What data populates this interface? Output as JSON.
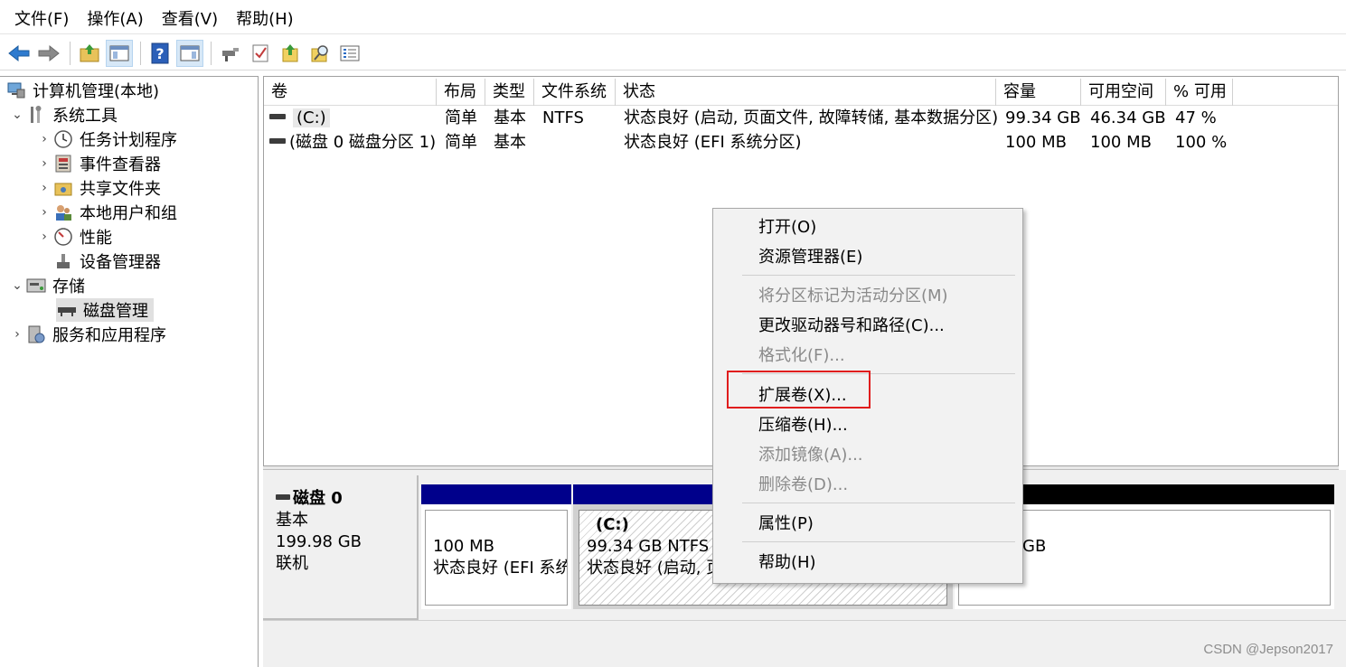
{
  "menu": [
    "文件(F)",
    "操作(A)",
    "查看(V)",
    "帮助(H)"
  ],
  "toolbar_icons": [
    "back-arrow-icon",
    "forward-arrow-icon",
    "up-folder-icon",
    "console-tree-icon",
    "help-icon",
    "action-pane-icon",
    "connect-icon",
    "properties-icon",
    "export-icon",
    "search-icon",
    "list-icon"
  ],
  "tree": {
    "root": "计算机管理(本地)",
    "system_tools": "系统工具",
    "task_scheduler": "任务计划程序",
    "event_viewer": "事件查看器",
    "shared_folders": "共享文件夹",
    "local_users": "本地用户和组",
    "performance": "性能",
    "device_manager": "设备管理器",
    "storage": "存储",
    "disk_management": "磁盘管理",
    "services": "服务和应用程序"
  },
  "volumes": {
    "columns": [
      "卷",
      "布局",
      "类型",
      "文件系统",
      "状态",
      "容量",
      "可用空间",
      "% 可用"
    ],
    "rows": [
      {
        "vol": "(C:)",
        "layout": "简单",
        "type": "基本",
        "fs": "NTFS",
        "status": "状态良好 (启动, 页面文件, 故障转储, 基本数据分区)",
        "capacity": "99.34 GB",
        "free": "46.34 GB",
        "pct": "47 %"
      },
      {
        "vol": "(磁盘 0 磁盘分区 1)",
        "layout": "简单",
        "type": "基本",
        "fs": "",
        "status": "状态良好 (EFI 系统分区)",
        "capacity": "100 MB",
        "free": "100 MB",
        "pct": "100 %"
      }
    ]
  },
  "disk": {
    "name": "磁盘 0",
    "type": "基本",
    "size": "199.98 GB",
    "state": "联机",
    "partitions": [
      {
        "size": "100 MB",
        "status": "状态良好 (EFI 系统"
      },
      {
        "label": "(C:)",
        "size": "99.34 GB NTFS",
        "status": "状态良好 (启动, 页"
      },
      {
        "size": "GB"
      }
    ]
  },
  "context_menu": {
    "open": "打开(O)",
    "explorer": "资源管理器(E)",
    "mark_active": "将分区标记为活动分区(M)",
    "change_letter": "更改驱动器号和路径(C)...",
    "format": "格式化(F)...",
    "extend": "扩展卷(X)...",
    "shrink": "压缩卷(H)...",
    "add_mirror": "添加镜像(A)...",
    "delete": "删除卷(D)...",
    "properties": "属性(P)",
    "help": "帮助(H)"
  },
  "colors": {
    "partition_bar_primary": "#00008b",
    "partition_bar_unalloc": "#000000",
    "highlight_box": "#e01d1d"
  },
  "watermark": "CSDN @Jepson2017"
}
